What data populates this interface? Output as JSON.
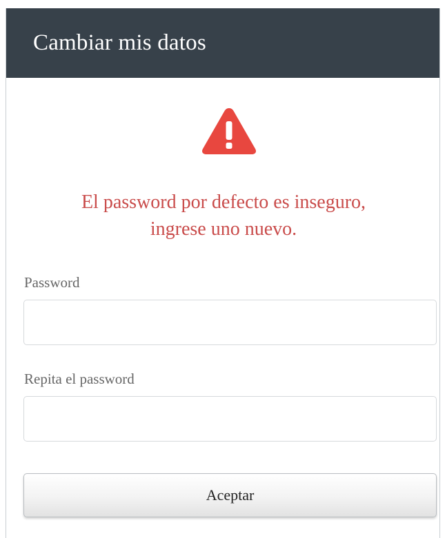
{
  "header": {
    "title": "Cambiar mis datos"
  },
  "alert": {
    "icon": "warning-triangle-icon",
    "color": "#e8473f",
    "message": "El password por defecto es inseguro, ingrese uno nuevo.",
    "message_color": "#c94b4a"
  },
  "form": {
    "password_label": "Password",
    "password_value": "",
    "repeat_label": "Repita el password",
    "repeat_value": "",
    "submit_label": "Aceptar"
  },
  "colors": {
    "header_bg": "#37414a",
    "header_text": "#ffffff"
  }
}
